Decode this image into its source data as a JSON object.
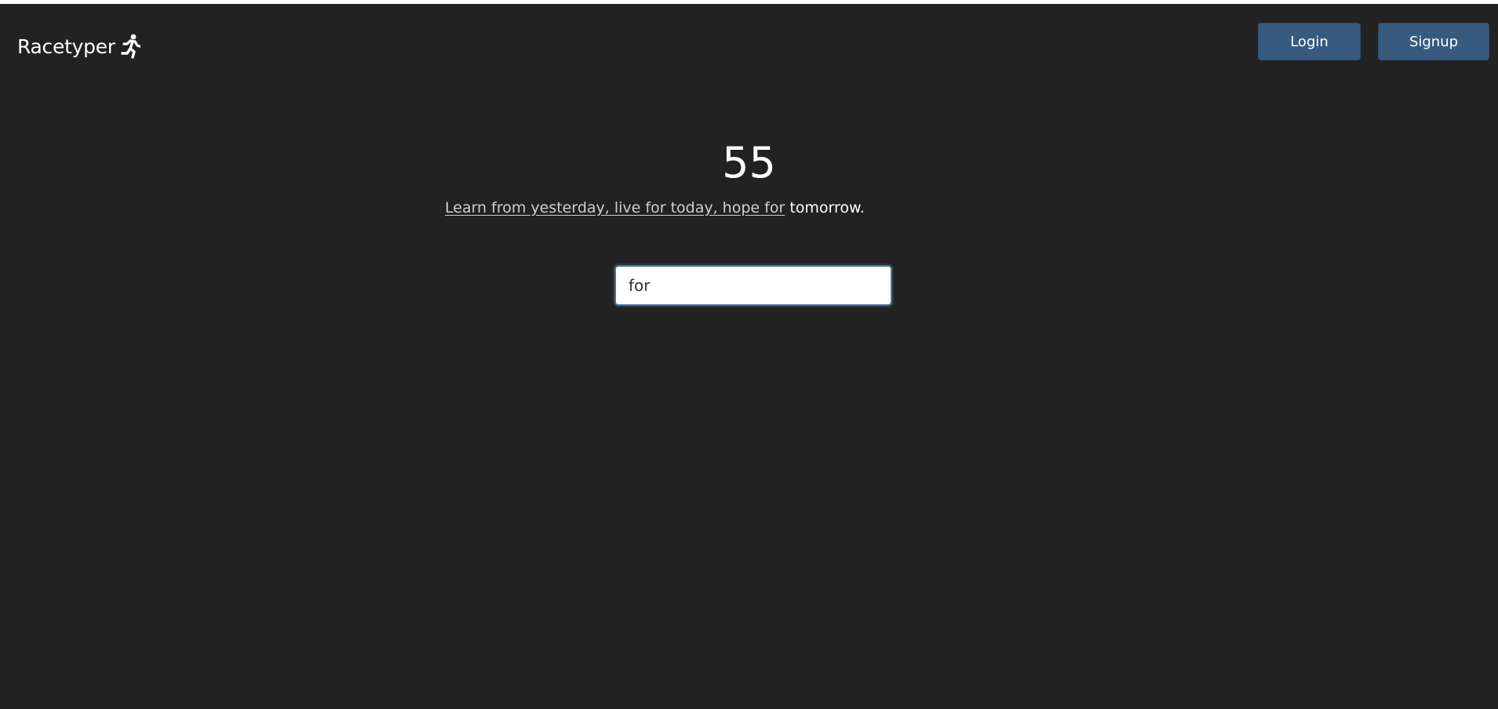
{
  "header": {
    "brand": "Racetyper",
    "brand_icon": "running-person-icon",
    "login_label": "Login",
    "signup_label": "Signup"
  },
  "race": {
    "timer": "55",
    "quote_typed": "Learn from yesterday, live for today, hope for",
    "quote_remaining": "tomorrow.",
    "input_value": "for"
  },
  "colors": {
    "background": "#222222",
    "button": "#375a7f",
    "text": "#ffffff"
  }
}
